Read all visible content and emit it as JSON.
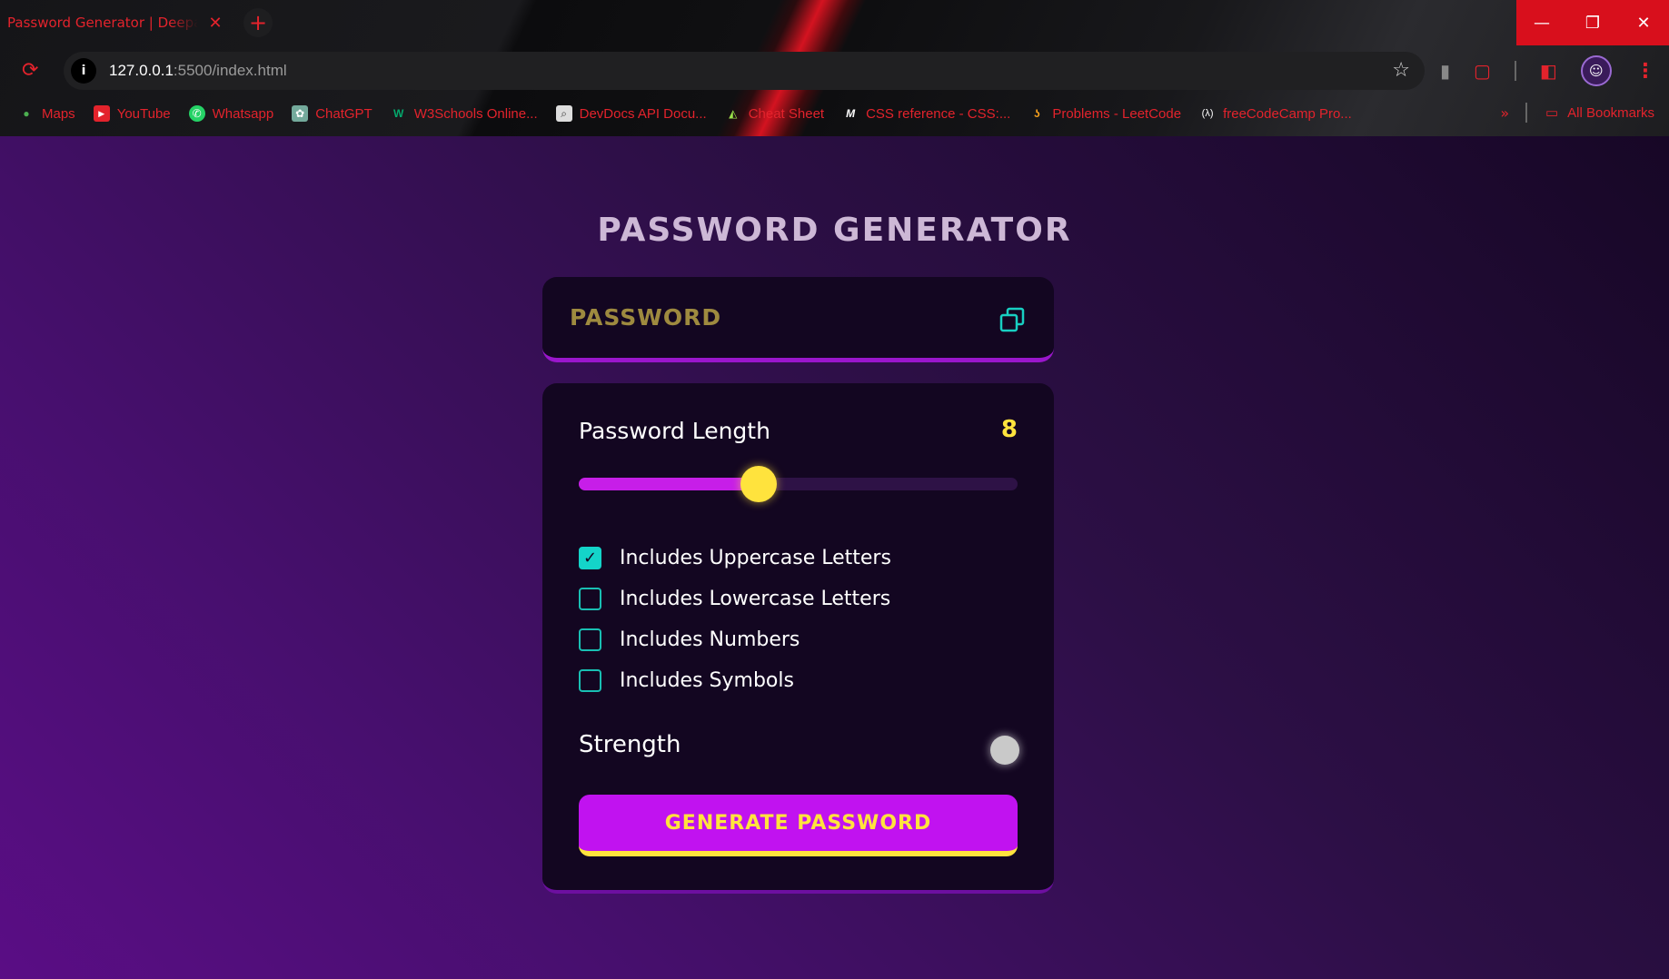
{
  "browser": {
    "tab_title": "Password Generator | Deepak S",
    "tab_close": "✕",
    "new_tab": "+",
    "window": {
      "minimize": "—",
      "restore": "❐",
      "close": "✕"
    },
    "url_host": "127.0.0.1",
    "url_rest": ":5500/index.html",
    "bookmarks": [
      {
        "label": "Maps",
        "icon": "maps-icon"
      },
      {
        "label": "YouTube",
        "icon": "youtube-icon"
      },
      {
        "label": "Whatsapp",
        "icon": "whatsapp-icon"
      },
      {
        "label": "ChatGPT",
        "icon": "chatgpt-icon"
      },
      {
        "label": "W3Schools Online...",
        "icon": "w3schools-icon"
      },
      {
        "label": "DevDocs API Docu...",
        "icon": "devdocs-icon"
      },
      {
        "label": "Cheat Sheet",
        "icon": "cheatsheet-icon"
      },
      {
        "label": "CSS reference - CSS:...",
        "icon": "mdn-icon"
      },
      {
        "label": "Problems - LeetCode",
        "icon": "leetcode-icon"
      },
      {
        "label": "freeCodeCamp Pro...",
        "icon": "freecodecamp-icon"
      }
    ],
    "bookmarks_more": "»",
    "all_bookmarks": "All Bookmarks"
  },
  "app": {
    "title": "PASSWORD GENERATOR",
    "password_placeholder": "PASSWORD",
    "length_label": "Password Length",
    "length_value": "8",
    "slider_fraction": 0.41,
    "options": [
      {
        "label": "Includes Uppercase Letters",
        "checked": true
      },
      {
        "label": "Includes Lowercase Letters",
        "checked": false
      },
      {
        "label": "Includes Numbers",
        "checked": false
      },
      {
        "label": "Includes Symbols",
        "checked": false
      }
    ],
    "strength_label": "Strength",
    "strength_color": "#c9c9c9",
    "generate_label": "GENERATE PASSWORD"
  },
  "colors": {
    "accent_yellow": "#ffe33d",
    "accent_purple": "#c112f0",
    "checkbox_teal": "#14d4c9",
    "browser_red": "#e3232c"
  }
}
